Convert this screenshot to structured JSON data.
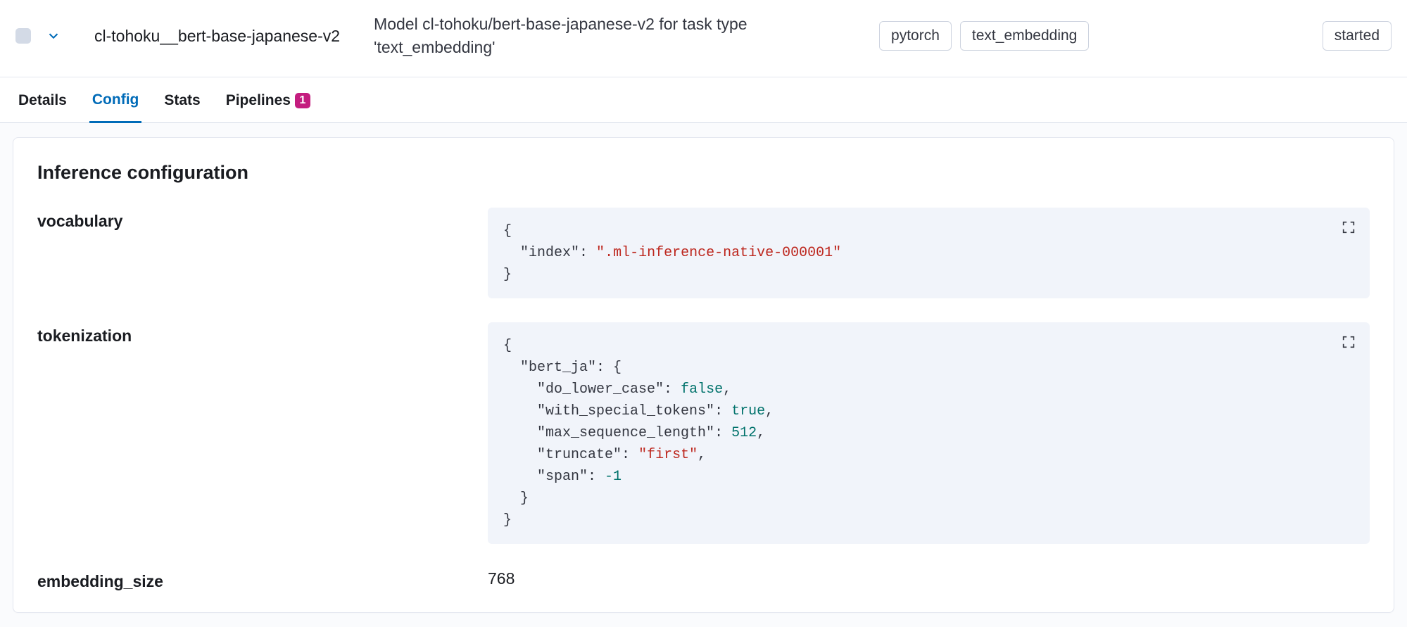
{
  "header": {
    "model_id": "cl-tohoku__bert-base-japanese-v2",
    "description": "Model cl-tohoku/bert-base-japanese-v2 for task type 'text_embedding'",
    "badges": [
      "pytorch",
      "text_embedding"
    ],
    "status": "started"
  },
  "tabs": {
    "details": "Details",
    "config": "Config",
    "stats": "Stats",
    "pipelines": "Pipelines",
    "pipelines_count": "1",
    "active": "config"
  },
  "panel": {
    "title": "Inference configuration",
    "vocabulary": {
      "label": "vocabulary",
      "json": {
        "index": ".ml-inference-native-000001"
      }
    },
    "tokenization": {
      "label": "tokenization",
      "json": {
        "bert_ja": {
          "do_lower_case": false,
          "with_special_tokens": true,
          "max_sequence_length": 512,
          "truncate": "first",
          "span": -1
        }
      }
    },
    "embedding_size": {
      "label": "embedding_size",
      "value": "768"
    }
  }
}
